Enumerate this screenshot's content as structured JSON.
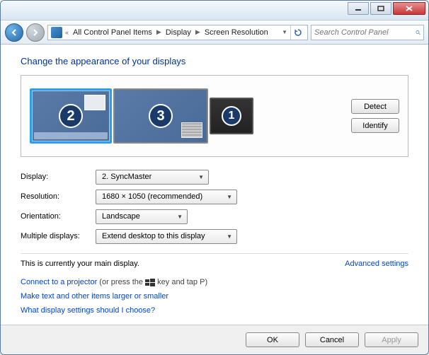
{
  "breadcrumb": {
    "items": [
      "All Control Panel Items",
      "Display",
      "Screen Resolution"
    ]
  },
  "search": {
    "placeholder": "Search Control Panel"
  },
  "heading": "Change the appearance of your displays",
  "monitors": {
    "m1": "1",
    "m2": "2",
    "m3": "3"
  },
  "buttons": {
    "detect": "Detect",
    "identify": "Identify",
    "ok": "OK",
    "cancel": "Cancel",
    "apply": "Apply"
  },
  "labels": {
    "display": "Display:",
    "resolution": "Resolution:",
    "orientation": "Orientation:",
    "multiple": "Multiple displays:"
  },
  "values": {
    "display": "2. SyncMaster",
    "resolution": "1680 × 1050 (recommended)",
    "orientation": "Landscape",
    "multiple": "Extend desktop to this display"
  },
  "status": {
    "main": "This is currently your main display.",
    "advanced": "Advanced settings"
  },
  "links": {
    "projector": "Connect to a projector",
    "projector_hint_pre": " (or press the ",
    "projector_hint_post": " key and tap P)",
    "textsize": "Make text and other items larger or smaller",
    "which": "What display settings should I choose?"
  }
}
